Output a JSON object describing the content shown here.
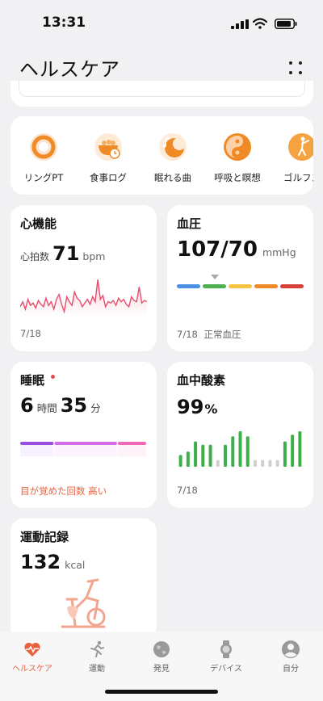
{
  "status_bar": {
    "time": "13:31"
  },
  "header": {
    "title": "ヘルスケア"
  },
  "shortcuts": [
    {
      "label": "リングPT",
      "icon": "ring-icon"
    },
    {
      "label": "食事ログ",
      "icon": "meal-bowl-icon"
    },
    {
      "label": "眠れる曲",
      "icon": "sleep-music-icon"
    },
    {
      "label": "呼吸と瞑想",
      "icon": "breathing-icon"
    },
    {
      "label": "ゴルフス",
      "icon": "golf-icon"
    }
  ],
  "heart": {
    "title": "心機能",
    "label": "心拍数",
    "value": "71",
    "unit": "bpm",
    "date": "7/18",
    "samples": [
      40,
      44,
      38,
      46,
      41,
      43,
      39,
      45,
      42,
      40,
      47,
      41,
      44,
      38,
      46,
      50,
      42,
      36,
      48,
      44,
      41,
      52,
      47,
      45,
      40,
      43,
      46,
      42,
      48,
      44,
      62,
      46,
      49,
      40,
      44,
      43,
      45,
      41,
      47,
      44,
      46,
      42,
      40,
      48,
      45,
      44,
      56,
      43,
      45,
      44
    ]
  },
  "bp": {
    "title": "血圧",
    "value": "107/70",
    "unit": "mmHg",
    "date": "7/18",
    "status": "正常血圧",
    "scale_colors": [
      "#4a90e2",
      "#4caf50",
      "#f5c542",
      "#f08a24",
      "#d9403a"
    ],
    "marker_position": 0.3
  },
  "sleep": {
    "title": "睡眠",
    "hours": "6",
    "hours_unit": "時間",
    "minutes": "35",
    "minutes_unit": "分",
    "note": "目が覚めた回数 高い",
    "stages": [
      {
        "color": "#9b4fe0",
        "fraction": 0.27
      },
      {
        "color": "#d46be8",
        "fraction": 0.5
      },
      {
        "color": "#f06ab3",
        "fraction": 0.23
      }
    ]
  },
  "spo2": {
    "title": "血中酸素",
    "value": "99",
    "unit": "%",
    "date": "7/18",
    "bars": [
      14,
      18,
      30,
      26,
      26,
      8,
      26,
      36,
      42,
      36,
      8,
      8,
      8,
      8,
      30,
      38,
      42
    ]
  },
  "exercise": {
    "title": "運動記録",
    "value": "132",
    "unit": "kcal"
  },
  "tabs": [
    {
      "label": "ヘルスケア",
      "icon": "heart-pulse-icon",
      "active": true
    },
    {
      "label": "運動",
      "icon": "runner-icon",
      "active": false
    },
    {
      "label": "発見",
      "icon": "globe-icon",
      "active": false
    },
    {
      "label": "デバイス",
      "icon": "watch-icon",
      "active": false
    },
    {
      "label": "自分",
      "icon": "profile-icon",
      "active": false
    }
  ],
  "colors": {
    "accent": "#e8603c",
    "heart_line": "#e84c6a",
    "spo2_bar": "#3cb04a",
    "spo2_empty": "#d0d0d0"
  }
}
